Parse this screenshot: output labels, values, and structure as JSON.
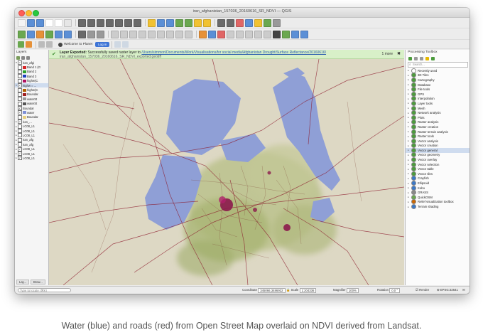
{
  "window": {
    "title": "iran_afghanistan_157036_20160616_SR_NDVI — QGIS"
  },
  "toolbar": {
    "planet_label": "Welcome to Planet",
    "login_label": "Log in"
  },
  "layers_panel": {
    "title": "Layers",
    "tabs": [
      "Lay...",
      "Brow..."
    ],
    "items": [
      {
        "label": "iran_afgi",
        "swatch": "",
        "checked": true,
        "arrow": "▾",
        "selected": false
      },
      {
        "label": "Band 1 (G",
        "swatch": "#d62728",
        "checked": false,
        "arrow": "",
        "selected": false
      },
      {
        "label": "Band 2",
        "swatch": "#2ca02c",
        "checked": false,
        "arrow": "",
        "selected": false
      },
      {
        "label": "Band 3",
        "swatch": "#1f3fbf",
        "checked": false,
        "arrow": "",
        "selected": false
      },
      {
        "label": "highw(C",
        "swatch": "#b01060",
        "checked": false,
        "arrow": "",
        "selected": false
      },
      {
        "label": "highw = ...",
        "swatch": "",
        "checked": true,
        "arrow": "▾",
        "selected": true
      },
      {
        "label": "highw(C",
        "swatch": "#b06000",
        "checked": false,
        "arrow": "",
        "selected": false
      },
      {
        "label": "Boundar",
        "swatch": "#a02020",
        "checked": false,
        "arrow": "",
        "selected": false
      },
      {
        "label": "waterSt",
        "swatch": "#999999",
        "checked": false,
        "arrow": "",
        "selected": false
      },
      {
        "label": "waterSt",
        "swatch": "#555555",
        "checked": false,
        "arrow": "",
        "selected": false
      },
      {
        "label": "Boundar",
        "swatch": "",
        "checked": true,
        "arrow": "",
        "selected": false
      },
      {
        "label": "water",
        "swatch": "#7f90d6",
        "checked": true,
        "arrow": "",
        "selected": false
      },
      {
        "label": "Boundar",
        "swatch": "#e8d080",
        "checked": false,
        "arrow": "",
        "selected": false
      },
      {
        "label": "iran_...",
        "swatch": "",
        "checked": true,
        "arrow": "▸",
        "selected": false
      },
      {
        "label": "LC08_L1",
        "swatch": "",
        "checked": false,
        "arrow": "▸",
        "selected": false
      },
      {
        "label": "LC08_L1",
        "swatch": "",
        "checked": false,
        "arrow": "▸",
        "selected": false
      },
      {
        "label": "LC08_L1",
        "swatch": "",
        "checked": false,
        "arrow": "▸",
        "selected": false
      },
      {
        "label": "iran_afg",
        "swatch": "",
        "checked": false,
        "arrow": "▸",
        "selected": false
      },
      {
        "label": "iran_afg",
        "swatch": "",
        "checked": false,
        "arrow": "▸",
        "selected": false
      },
      {
        "label": "LC08_L1",
        "swatch": "",
        "checked": true,
        "arrow": "▸",
        "selected": false
      },
      {
        "label": "LC08_L1",
        "swatch": "",
        "checked": true,
        "arrow": "▸",
        "selected": false
      },
      {
        "label": "LC08_L1",
        "swatch": "",
        "checked": true,
        "arrow": "▸",
        "selected": false
      }
    ]
  },
  "message_bar": {
    "prefix": "Layer Exported:",
    "text": " Successfully saved raster layer to ",
    "link": "/Users/simmon/Documents/Work/Visualisations/for social media/Afghanistan Drought/Surface Reflectance/20160616/",
    "line2": "iran_afghanistan_157036_20160616_SR_NDVI_exported.geotiff",
    "more_label": "1 more",
    "close_symbol": "✖"
  },
  "toolbox": {
    "title": "Processing Toolbox",
    "search_placeholder": "Search...",
    "items": [
      {
        "label": "Recently used",
        "icon_color": "#ffffff",
        "selected": false
      },
      {
        "label": "3D Tiles",
        "icon_color": "#4c9b3c",
        "selected": false
      },
      {
        "label": "Cartography",
        "icon_color": "#4c9b3c",
        "selected": false
      },
      {
        "label": "Database",
        "icon_color": "#4c9b3c",
        "selected": false
      },
      {
        "label": "File tools",
        "icon_color": "#4c9b3c",
        "selected": false
      },
      {
        "label": "GPS",
        "icon_color": "#4c9b3c",
        "selected": false
      },
      {
        "label": "Interpolation",
        "icon_color": "#4c9b3c",
        "selected": false
      },
      {
        "label": "Layer tools",
        "icon_color": "#4c9b3c",
        "selected": false
      },
      {
        "label": "Mesh",
        "icon_color": "#4c9b3c",
        "selected": false
      },
      {
        "label": "Network analysis",
        "icon_color": "#4c9b3c",
        "selected": false
      },
      {
        "label": "Plots",
        "icon_color": "#4c9b3c",
        "selected": false
      },
      {
        "label": "Raster analysis",
        "icon_color": "#4c9b3c",
        "selected": false
      },
      {
        "label": "Raster creation",
        "icon_color": "#4c9b3c",
        "selected": false
      },
      {
        "label": "Raster terrain analysis",
        "icon_color": "#4c9b3c",
        "selected": false
      },
      {
        "label": "Raster tools",
        "icon_color": "#4c9b3c",
        "selected": false
      },
      {
        "label": "Vector analysis",
        "icon_color": "#4c9b3c",
        "selected": false
      },
      {
        "label": "Vector creation",
        "icon_color": "#4c9b3c",
        "selected": false
      },
      {
        "label": "Vector general",
        "icon_color": "#4c9b3c",
        "selected": true
      },
      {
        "label": "Vector geometry",
        "icon_color": "#4c9b3c",
        "selected": false
      },
      {
        "label": "Vector overlay",
        "icon_color": "#4c9b3c",
        "selected": false
      },
      {
        "label": "Vector selection",
        "icon_color": "#4c9b3c",
        "selected": false
      },
      {
        "label": "Vector table",
        "icon_color": "#4c9b3c",
        "selected": false
      },
      {
        "label": "Vector tiles",
        "icon_color": "#4c9b3c",
        "selected": false
      },
      {
        "label": "Crayfish",
        "icon_color": "#3a78c8",
        "selected": false
      },
      {
        "label": "Ellipsoid",
        "icon_color": "#3a78c8",
        "selected": false
      },
      {
        "label": "Kobo",
        "icon_color": "#3a78c8",
        "selected": false
      },
      {
        "label": "GRASS",
        "icon_color": "#888888",
        "selected": false
      },
      {
        "label": "QuickOSM",
        "icon_color": "#6aa84f",
        "selected": false
      },
      {
        "label": "Relief visualization toolbox",
        "icon_color": "#cc6600",
        "selected": false
      },
      {
        "label": "Terrain shading",
        "icon_color": "#3a78c8",
        "selected": false
      }
    ]
  },
  "statusbar": {
    "locate_placeholder": "Type to locate (⌘K)",
    "coordinate_label": "Coordinate",
    "coordinate_value": "345066,3486932",
    "scale_label": "Scale",
    "scale_value": "1:204336",
    "magnifier_label": "Magnifier",
    "magnifier_value": "100%",
    "rotation_label": "Rotation",
    "rotation_value": "0.0 °",
    "render_label": "Render",
    "crs_label": "EPSG:32641"
  },
  "map": {
    "water_color": "#8f9fd6",
    "road_color": "#8c1a2c",
    "background_color": "#ddd8c4"
  },
  "caption": "Water (blue) and roads (red) from Open Street Map overlaid on NDVI derived from Landsat."
}
